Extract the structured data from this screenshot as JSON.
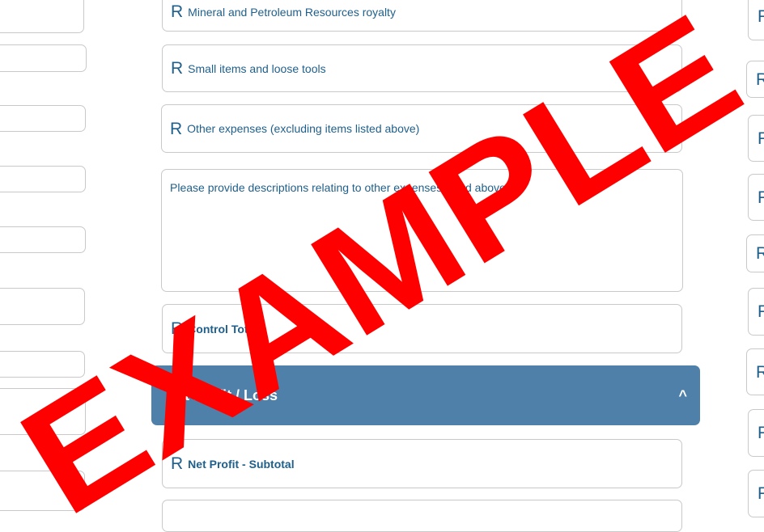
{
  "currency_symbol": "R",
  "middle": {
    "fields": [
      "Mineral and Petroleum Resources royalty",
      "Small items and loose tools",
      "Other expenses (excluding items listed above)"
    ],
    "description_label": "Please provide descriptions relating to other expenses listed above",
    "control_total_label": "Control Total",
    "net_profit_label": "Net Profit - Subtotal"
  },
  "section": {
    "title": "Net Profit / Loss",
    "toggle_icon": "^"
  },
  "right_symbols": [
    "R",
    "R",
    "R",
    "R",
    "R",
    "R",
    "R",
    "R",
    "R"
  ],
  "watermark": {
    "text": "EXAMPLE",
    "color": "#ff0000"
  }
}
